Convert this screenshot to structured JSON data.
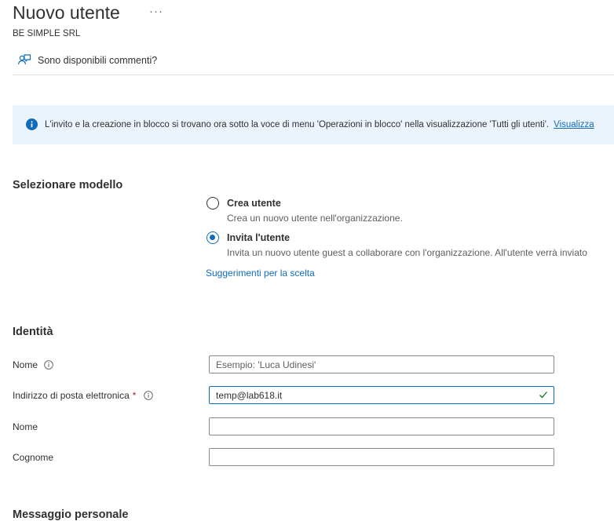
{
  "header": {
    "title": "Nuovo utente",
    "more_label": "···",
    "org": "BE SIMPLE SRL",
    "feedback_label": "Sono disponibili commenti?"
  },
  "banner": {
    "text": "L'invito e la creazione in blocco si trovano ora sotto la voce di menu 'Operazioni in blocco' nella visualizzazione 'Tutti gli utenti'.",
    "link": "Visualizza"
  },
  "template": {
    "title": "Selezionare modello",
    "options": [
      {
        "label": "Crea utente",
        "desc": "Crea un nuovo utente nell'organizzazione.",
        "selected": false
      },
      {
        "label": "Invita l'utente",
        "desc": "Invita un nuovo utente guest a collaborare con l'organizzazione. All'utente verrà inviato",
        "selected": true
      }
    ],
    "help_link": "Suggerimenti per la scelta"
  },
  "identity": {
    "title": "Identità",
    "fields": [
      {
        "label": "Nome",
        "info": true,
        "required": false,
        "value": "",
        "placeholder": "Esempio: 'Luca Udinesi'"
      },
      {
        "label": "Indirizzo di posta elettronica",
        "info": true,
        "required": true,
        "value": "temp@lab618.it",
        "placeholder": ""
      },
      {
        "label": "Nome",
        "info": false,
        "required": false,
        "value": "",
        "placeholder": ""
      },
      {
        "label": "Cognome",
        "info": false,
        "required": false,
        "value": "",
        "placeholder": ""
      }
    ],
    "required_mark": "*"
  },
  "next_section": {
    "title": "Messaggio personale"
  },
  "colors": {
    "accent": "#0f6cbd",
    "banner_bg": "#ebf3fc",
    "required": "#a4262c",
    "valid_check": "#107c10"
  },
  "icons": [
    "feedback-icon",
    "info-circle-icon",
    "info-outline-icon",
    "checkmark-icon"
  ]
}
